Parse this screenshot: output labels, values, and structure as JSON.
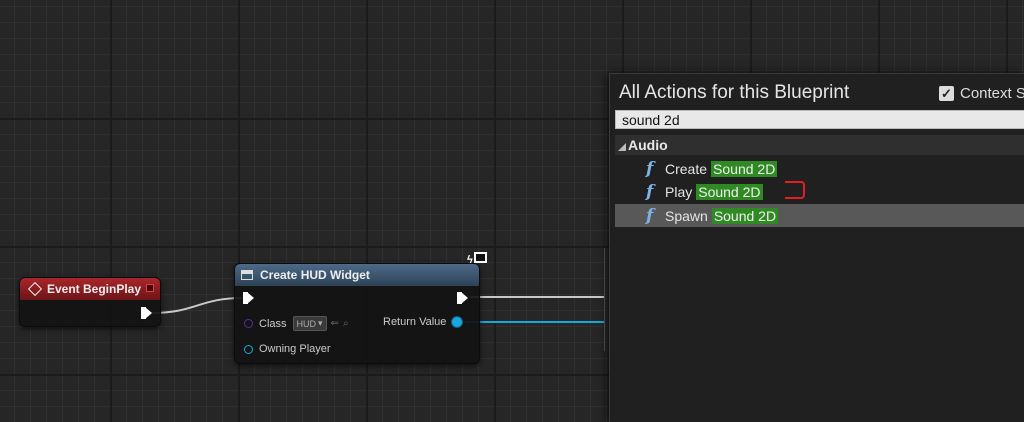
{
  "graph": {
    "event_node": {
      "title": "Event BeginPlay"
    },
    "hud_node": {
      "title": "Create HUD Widget",
      "class_label": "Class",
      "class_value": "HUD",
      "owning_player_label": "Owning Player",
      "return_value_label": "Return Value"
    }
  },
  "action_menu": {
    "title": "All Actions for this Blueprint",
    "context_label": "Context S",
    "context_checked": true,
    "search_value": "sound 2d",
    "category": "Audio",
    "items": [
      {
        "prefix": "Create",
        "highlight": "Sound 2D"
      },
      {
        "prefix": "Play",
        "highlight": "Sound 2D"
      },
      {
        "prefix": "Spawn",
        "highlight": "Sound 2D"
      }
    ],
    "selected_index": 2
  },
  "colors": {
    "event_header": "#a8262a",
    "hud_header": "#4d6a88",
    "object_pin": "#1ca6de",
    "class_pin": "#5a2ca0",
    "highlight": "#2f8a24",
    "annotation": "#e02020"
  },
  "icons": {
    "event": "event-diamond-icon",
    "widget": "widget-icon",
    "function": "function-f-icon",
    "network": "network-screen-icon"
  }
}
